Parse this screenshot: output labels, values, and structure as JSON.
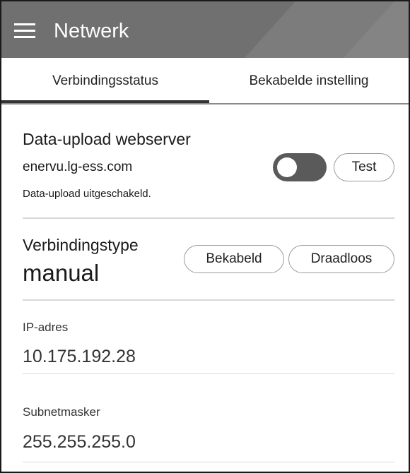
{
  "appbar": {
    "title": "Netwerk",
    "menu_icon": "hamburger-menu-icon",
    "color": "#707070"
  },
  "tabs": [
    {
      "label": "Verbindingsstatus",
      "selected": true
    },
    {
      "label": "Bekabelde instelling",
      "selected": false
    }
  ],
  "webserver": {
    "title": "Data-upload webserver",
    "host": "enervu.lg-ess.com",
    "status": "Data-upload uitgeschakeld.",
    "toggle_on": false,
    "test_label": "Test"
  },
  "connection": {
    "label": "Verbindingstype",
    "value": "manual",
    "wired_label": "Bekabeld",
    "wireless_label": "Draadloos"
  },
  "ip": {
    "label": "IP-adres",
    "value": "10.175.192.28"
  },
  "subnet": {
    "label": "Subnetmasker",
    "value": "255.255.255.0"
  }
}
